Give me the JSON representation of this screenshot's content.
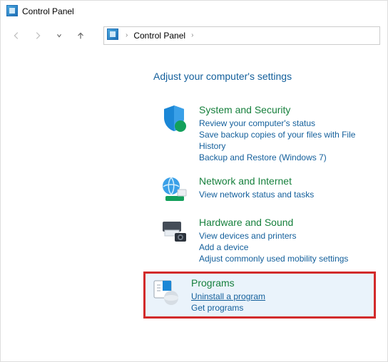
{
  "window": {
    "title": "Control Panel"
  },
  "breadcrumb": {
    "root_sep": "›",
    "item": "Control Panel",
    "trail_sep": "›"
  },
  "heading": "Adjust your computer's settings",
  "categories": {
    "system": {
      "title": "System and Security",
      "links": [
        "Review your computer's status",
        "Save backup copies of your files with File History",
        "Backup and Restore (Windows 7)"
      ]
    },
    "network": {
      "title": "Network and Internet",
      "links": [
        "View network status and tasks"
      ]
    },
    "hardware": {
      "title": "Hardware and Sound",
      "links": [
        "View devices and printers",
        "Add a device",
        "Adjust commonly used mobility settings"
      ]
    },
    "programs": {
      "title": "Programs",
      "links": [
        "Uninstall a program",
        "Get programs"
      ]
    }
  }
}
